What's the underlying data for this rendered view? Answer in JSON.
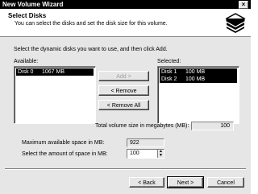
{
  "window": {
    "title": "New Volume Wizard",
    "close_label": "×"
  },
  "header": {
    "title": "Select Disks",
    "subtitle": "You can select the disks and set the disk size for this volume."
  },
  "instructions": "Select the dynamic disks you want to use, and then click Add.",
  "available": {
    "label": "Available:",
    "items": [
      {
        "name": "Disk 0",
        "size": "1067 MB"
      }
    ]
  },
  "selected": {
    "label": "Selected:",
    "items": [
      {
        "name": "Disk 1",
        "size": "100 MB"
      },
      {
        "name": "Disk 2",
        "size": "100 MB"
      }
    ]
  },
  "buttons": {
    "add": "Add >",
    "remove": "< Remove",
    "remove_all": "< Remove All",
    "back": "< Back",
    "next": "Next >",
    "cancel": "Cancel"
  },
  "total": {
    "label": "Total volume size in megabytes (MB):",
    "value": "100"
  },
  "max_space": {
    "label": "Maximum available space in MB:",
    "value": "922"
  },
  "amount": {
    "label": "Select the amount of space in MB:",
    "value": "100"
  }
}
